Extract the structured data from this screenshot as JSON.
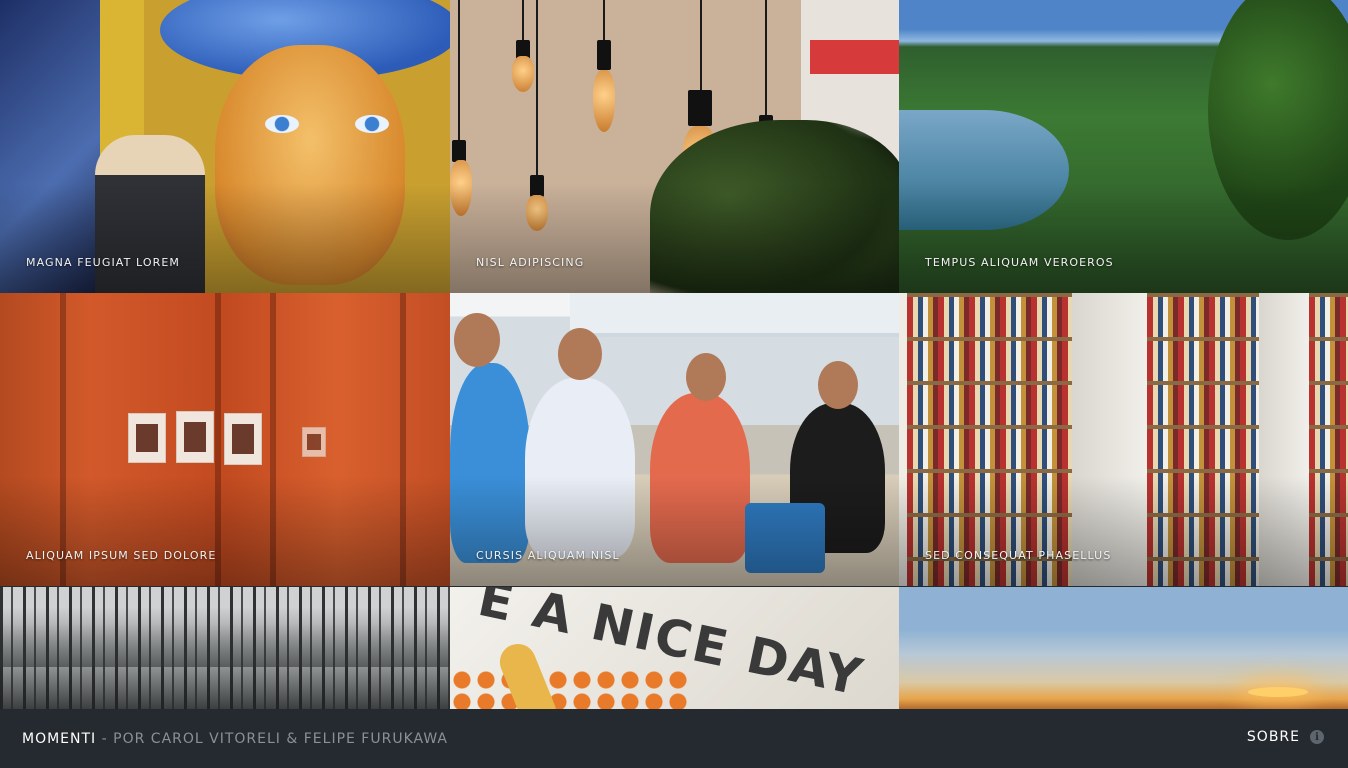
{
  "gallery": {
    "tiles": [
      {
        "caption": "MAGNA FEUGIAT LOREM"
      },
      {
        "caption": "NISL ADIPISCING"
      },
      {
        "caption": "TEMPUS ALIQUAM VEROEROS"
      },
      {
        "caption": "ALIQUAM IPSUM SED DOLORE"
      },
      {
        "caption": "CURSIS ALIQUAM NISL"
      },
      {
        "caption": "SED CONSEQUAT PHASELLUS"
      },
      {
        "caption": ""
      },
      {
        "caption": ""
      },
      {
        "caption": ""
      }
    ],
    "shirt_print": "E A NICE DAY"
  },
  "footer": {
    "brand_name": "MOMENTI",
    "separator": "-",
    "byline": "POR CAROL VITORELI & FELIPE FURUKAWA",
    "about_label": "SOBRE",
    "about_icon": "info-icon",
    "info_glyph": "i"
  }
}
